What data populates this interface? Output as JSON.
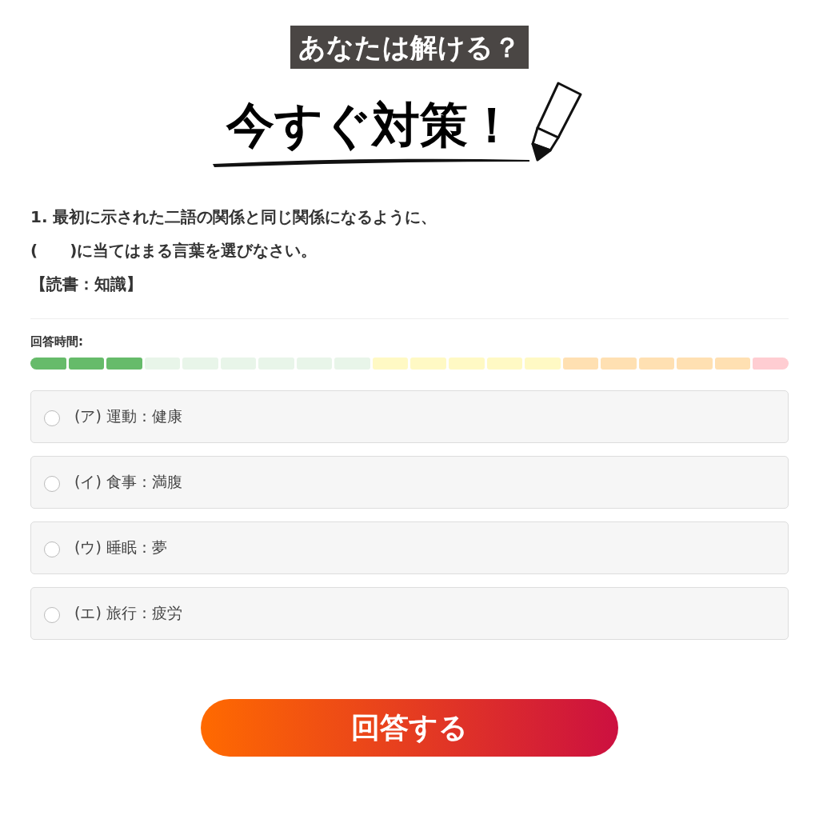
{
  "header": {
    "badge": "あなたは解ける？",
    "headline": "今すぐ対策！"
  },
  "question": {
    "lines": [
      "1. 最初に示された二語の関係と同じ関係になるように、",
      "(　　)に当てはまる言葉を選びなさい。"
    ],
    "category": "【読書：知識】"
  },
  "timer": {
    "label": "回答時間:",
    "segments": [
      {
        "color": "#66bb6a"
      },
      {
        "color": "#66bb6a"
      },
      {
        "color": "#66bb6a"
      },
      {
        "color": "#e8f5e9"
      },
      {
        "color": "#e8f5e9"
      },
      {
        "color": "#e8f5e9"
      },
      {
        "color": "#e8f5e9"
      },
      {
        "color": "#e8f5e9"
      },
      {
        "color": "#e8f5e9"
      },
      {
        "color": "#fff9c4"
      },
      {
        "color": "#fff9c4"
      },
      {
        "color": "#fff9c4"
      },
      {
        "color": "#fff9c4"
      },
      {
        "color": "#fff9c4"
      },
      {
        "color": "#ffe0b2"
      },
      {
        "color": "#ffe0b2"
      },
      {
        "color": "#ffe0b2"
      },
      {
        "color": "#ffe0b2"
      },
      {
        "color": "#ffe0b2"
      },
      {
        "color": "#ffcdd2"
      }
    ]
  },
  "options": [
    {
      "label": "(ア) 運動：健康",
      "selected": false
    },
    {
      "label": "(イ) 食事：満腹",
      "selected": false
    },
    {
      "label": "(ウ) 睡眠：夢",
      "selected": false
    },
    {
      "label": "(エ) 旅行：疲労",
      "selected": false
    }
  ],
  "submit": "回答する"
}
